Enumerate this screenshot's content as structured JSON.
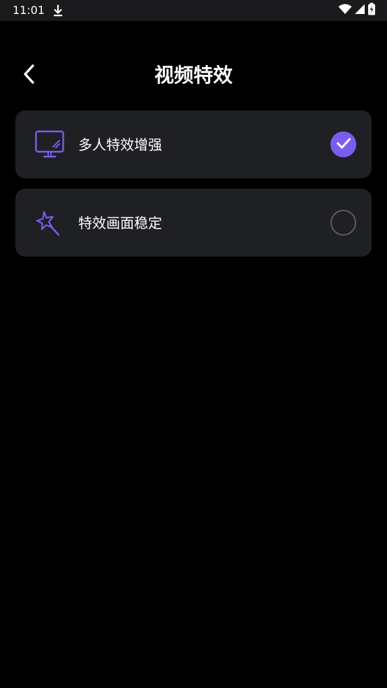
{
  "status_bar": {
    "time": "11:01"
  },
  "header": {
    "title": "视频特效",
    "back_icon": "chevron-left-icon"
  },
  "options": [
    {
      "label": "多人特效增强",
      "icon": "monitor-icon",
      "selected": true
    },
    {
      "label": "特效画面稳定",
      "icon": "magic-wand-icon",
      "selected": false
    }
  ],
  "colors": {
    "background": "#000000",
    "card": "#1f2024",
    "accent": "#7b5cf0",
    "unchecked_border": "#5a5b60"
  }
}
